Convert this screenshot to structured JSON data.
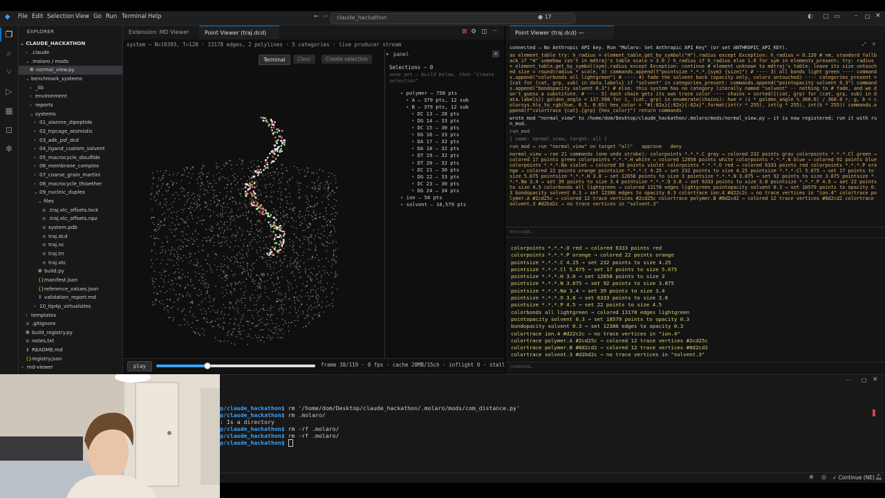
{
  "menu": [
    "File",
    "Edit",
    "Selection",
    "View",
    "Go",
    "Run",
    "Terminal",
    "Help"
  ],
  "search": {
    "text": "claude_hackathon"
  },
  "title_badge": "17",
  "explorer": {
    "header": "EXPLORER",
    "root": "CLAUDE_HACKATHON",
    "items": [
      {
        "label": ".claude",
        "depth": 1,
        "type": "folder",
        "open": false
      },
      {
        "label": ".molaro / mods",
        "depth": 1,
        "type": "folder",
        "open": true
      },
      {
        "label": "normal_view.py",
        "depth": 2,
        "type": "py",
        "selected": true
      },
      {
        "label": "benchmark_systems",
        "depth": 1,
        "type": "folder",
        "open": true
      },
      {
        "label": "_lib",
        "depth": 2,
        "type": "folder",
        "open": false
      },
      {
        "label": "environment",
        "depth": 2,
        "type": "folder",
        "open": false
      },
      {
        "label": "reports",
        "depth": 2,
        "type": "folder",
        "open": false
      },
      {
        "label": "systems",
        "depth": 2,
        "type": "folder",
        "open": true
      },
      {
        "label": "01_alanine_dipeptide",
        "depth": 3,
        "type": "folder",
        "open": false
      },
      {
        "label": "02_trpcage_atomistic",
        "depth": 3,
        "type": "folder",
        "open": false
      },
      {
        "label": "03_adk_psf_dcd",
        "depth": 3,
        "type": "folder",
        "open": false
      },
      {
        "label": "04_ligand_custom_solvent",
        "depth": 3,
        "type": "folder",
        "open": false
      },
      {
        "label": "05_macrocycle_disulfide",
        "depth": 3,
        "type": "folder",
        "open": false
      },
      {
        "label": "06_membrane_complex",
        "depth": 3,
        "type": "folder",
        "open": false
      },
      {
        "label": "07_coarse_grain_martini",
        "depth": 3,
        "type": "folder",
        "open": false
      },
      {
        "label": "08_macrocycle_thioether",
        "depth": 3,
        "type": "folder",
        "open": false
      },
      {
        "label": "09_nucleic_duplex",
        "depth": 3,
        "type": "folder",
        "open": true
      },
      {
        "label": "files",
        "depth": 4,
        "type": "folder",
        "open": true
      },
      {
        "label": ".traj.xtc_offsets.lock",
        "depth": 5,
        "type": "file"
      },
      {
        "label": ".traj.xtc_offsets.npz",
        "depth": 5,
        "type": "file"
      },
      {
        "label": "system.pdb",
        "depth": 5,
        "type": "file"
      },
      {
        "label": "traj.dcd",
        "depth": 5,
        "type": "file"
      },
      {
        "label": "traj.nc",
        "depth": 5,
        "type": "file"
      },
      {
        "label": "traj.trr",
        "depth": 5,
        "type": "file"
      },
      {
        "label": "traj.xtc",
        "depth": 5,
        "type": "file"
      },
      {
        "label": "build.py",
        "depth": 4,
        "type": "py"
      },
      {
        "label": "manifest.json",
        "depth": 4,
        "type": "json"
      },
      {
        "label": "reference_values.json",
        "depth": 4,
        "type": "json"
      },
      {
        "label": "validation_report.md",
        "depth": 4,
        "type": "md"
      },
      {
        "label": "10_tip4p_virtualsites",
        "depth": 3,
        "type": "folder",
        "open": false
      },
      {
        "label": "templates",
        "depth": 1,
        "type": "folder",
        "open": false
      },
      {
        "label": ".gitignore",
        "depth": 1,
        "type": "file"
      },
      {
        "label": "build_registry.py",
        "depth": 1,
        "type": "py"
      },
      {
        "label": "notes.txt",
        "depth": 1,
        "type": "file"
      },
      {
        "label": "README.md",
        "depth": 1,
        "type": "md"
      },
      {
        "label": "registry.json",
        "depth": 1,
        "type": "json"
      },
      {
        "label": "md-viewer",
        "depth": 0,
        "type": "folder",
        "open": false
      }
    ]
  },
  "editor_tabs": [
    {
      "label": "Extension: MD Viewer",
      "active": false
    },
    {
      "label": "Point Viewer (traj.dcd)",
      "active": true
    }
  ],
  "viewer": {
    "status": "system — N=19393, T=120 · 13178 edges, 2 polylines · 5 categories · live producer stream",
    "buttons": {
      "terminal": "Terminal",
      "clear": "Clear",
      "create": "Create selection"
    },
    "panel_title": "panel",
    "selections_label": "Selections — 0",
    "selections_hint": "none yet — build below, then \"Create selection\"",
    "tree": [
      {
        "label": "polymer — 758 pts",
        "depth": 0
      },
      {
        "label": "A — 379 pts, 12 sub",
        "depth": 1
      },
      {
        "label": "B — 379 pts, 12 sub",
        "depth": 1
      },
      {
        "label": "DC 13 — 28 pts",
        "depth": 2
      },
      {
        "label": "DG 14 — 33 pts",
        "depth": 2
      },
      {
        "label": "DC 15 — 30 pts",
        "depth": 2
      },
      {
        "label": "DG 16 — 33 pts",
        "depth": 2
      },
      {
        "label": "DA 17 — 32 pts",
        "depth": 2
      },
      {
        "label": "DA 18 — 32 pts",
        "depth": 2
      },
      {
        "label": "DT 19 — 32 pts",
        "depth": 2
      },
      {
        "label": "DT 20 — 32 pts",
        "depth": 2
      },
      {
        "label": "DC 21 — 30 pts",
        "depth": 2
      },
      {
        "label": "DG 22 — 33 pts",
        "depth": 2
      },
      {
        "label": "DC 23 — 30 pts",
        "depth": 2
      },
      {
        "label": "DG 24 — 34 pts",
        "depth": 2
      },
      {
        "label": "ion — 56 pts",
        "depth": 0
      },
      {
        "label": "solvent — 18,579 pts",
        "depth": 0
      }
    ],
    "play_label": "play",
    "frame_info": "frame 38/119 · 0 fps · cache 28MB/15ch · inflight 0 · stalls 0",
    "progress": 0.32
  },
  "right": {
    "tab": "Point Viewer (traj.dcd) — Terminal",
    "chat": [
      {
        "text": "connected — No Anthropic API key. Run \"Molaro: Set Anthropic API Key\" (or set ANTHROPIC_API_KEY).",
        "color": "#d7d7d7"
      },
      {
        "text": "as element_table try: h_radius = element_table.get_by_symbol(\"H\").radius except Exception: h_radius = 0.120 # nm, standard fallback if \"H\" somehow isn't in mdtraj's table scale = 3.0 / h_radius if h_radius else 1.0 for sym in elements_present: try: radius = element_table.get_by_symbol(sym).radius except Exception: continue # element unknown to mdtraj's table: leave its size untouched size = round(radius * scale, 3) commands.append(f\"pointsize *.*.*.{sym} {size}\") # ---- 3) all bonds light green ---- commands.append(\"colorbonds all lightgreen\") # ---- 4) fade the solvent back (opacity only, colors untouched) ---- categories_present = {cat for (cat, grp, sub) in data.labels} if \"solvent\" in categories_present: commands.append(\"pointopacity solvent 0.3\") commands.append(\"bondopacity solvent 0.3\") # else: this system has no category literally named \"solvent\" -- nothing to # fade, and we don't guess a substitute. # ---- 5) each chain gets its own trace color ---- chains = sorted({(cat, grp) for (cat, grp, sub) in data.labels}) golden_angle = 137.508 for i, (cat, grp) in enumerate(chains): hue = (i * golden_angle % 360.0) / 360.0 r, g, b = colorsys.hls_to_rgb(hue, 0.5, 0.65) hex_color = \"#{:02x}{:02x}{:02x}\".format(int(r * 255), int(g * 255), int(b * 255)) commands.append(f\"colortrace {cat}.{grp} {hex_color}\") return commands",
        "color": "#e0b060"
      },
      {
        "text": "wrote mod \"normal_view\" to /home/dom/Desktop/claude_hackathon/.molaro/mods/normal_view.py — it is now registered; run it with run_mod.",
        "color": "#d7d7d7"
      },
      {
        "text": "run_mod",
        "color": "#9a9a9a"
      },
      {
        "text": "{ name: normal_view, target: all }",
        "color": "#777"
      },
      {
        "text": "run_mod → run \"normal_view\" on target \"all\"   approve   deny",
        "color": "#e0b060"
      },
      {
        "text": "normal_view → ran 21 commands (one undo stroke): colorpoints *.*.*.C gray → colored 232 points gray colorpoints *.*.*.Cl green → colored 17 points green colorpoints *.*.*.H white → colored 12658 points white colorpoints *.*.*.N blue → colored 92 points blue colorpoints *.*.*.Na violet → colored 39 points violet colorpoints *.*.*.O red → colored 6333 points red colorpoints *.*.*.P orange → colored 22 points orange pointsize *.*.*.C 4.25 → set 232 points to size 4.25 pointsize *.*.*.Cl 5.675 → set 17 points to size 5.675 pointsize *.*.*.H 3.0 → set 12658 points to size 3 pointsize *.*.*.N 3.875 → set 92 points to size 3.875 pointsize *.*.*.Na 3.4 → set 39 points to size 3.4 pointsize *.*.*.O 3.8 → set 6333 points to size 3.8 pointsize *.*.*.P 4.5 → set 22 points to size 4.5 colorbonds all lightgreen → colored 13178 edges lightgreen pointopacity solvent 0.3 → set 18579 points to opacity 0.3 bondopacity solvent 0.3 → set 12386 edges to opacity 0.3 colortrace ion.4 #d22c2c → no trace vertices in \"ion.4\" colortrace polymer.A #2cd25c → colored 12 trace vertices #2cd25c colortrace polymer.B #8d2cd2 → colored 12 trace vertices #8d2cd2 colortrace solvent.3 #d2bd2c → no trace vertices in \"solvent.3\"",
        "color": "#e0b060"
      }
    ],
    "message_placeholder": "message…",
    "log": [
      "colorpoints *.*.*.O red → colored 6333 points red",
      "colorpoints *.*.*.P orange → colored 22 points orange",
      "pointsize *.*.*.C 4.25 → set 232 points to size 4.25",
      "pointsize *.*.*.Cl 5.675 → set 17 points to size 5.675",
      "pointsize *.*.*.H 3.0 → set 12658 points to size 3",
      "pointsize *.*.*.N 3.875 → set 92 points to size 3.875",
      "pointsize *.*.*.Na 3.4 → set 39 points to size 3.4",
      "pointsize *.*.*.O 3.8 → set 6333 points to size 3.8",
      "pointsize *.*.*.P 4.5 → set 22 points to size 4.5",
      "colorbonds all lightgreen → colored 13178 edges lightgreen",
      "pointopacity solvent 0.3 → set 18579 points to opacity 0.3",
      "bondopacity solvent 0.3 → set 12386 edges to opacity 0.3",
      "colortrace ion.4 #d22c2c → no trace vertices in \"ion.4\"",
      "colortrace polymer.A #2cd25c → colored 12 trace vertices #2cd25c",
      "colortrace polymer.B #8d2cd2 → colored 12 trace vertices #8d2cd2",
      "colortrace solvent.3 #d2bd2c → no trace vertices in \"solvent.3\""
    ],
    "command_placeholder": "command…"
  },
  "terminal": {
    "lines": [
      {
        "prompt": "p/claude_hackathon$",
        "cmd": " rm '/home/dom/Desktop/claude_hackathon/.molaro/mods/com_distance.py'"
      },
      {
        "prompt": "p/claude_hackathon$",
        "cmd": " rm .molaro/"
      },
      {
        "prompt": "",
        "cmd": ": Is a directory"
      },
      {
        "prompt": "p/claude_hackathon$",
        "cmd": " rm -rf .molaro/"
      },
      {
        "prompt": "p/claude_hackathon$",
        "cmd": " rm -rf .molaro/"
      },
      {
        "prompt": "p/claude_hackathon$",
        "cmd": " "
      }
    ]
  },
  "statusbar": {
    "continue": "Continue (NE)"
  },
  "colors": {
    "accent": "#0078d4",
    "prompt": "#3ba3ff",
    "log": "#d7d36c",
    "chat": "#e0b060"
  }
}
